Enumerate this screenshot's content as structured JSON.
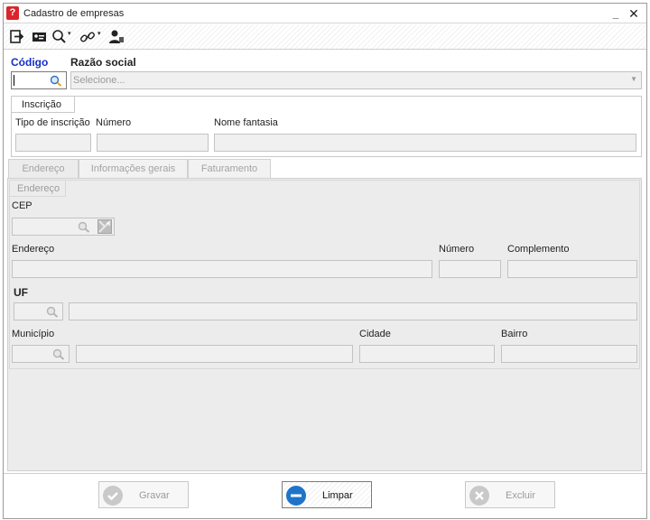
{
  "window": {
    "title": "Cadastro de empresas",
    "app_icon_glyph": "?",
    "minimize_glyph": "_",
    "close_glyph": "✕"
  },
  "toolbar": {
    "icons": [
      "exit-icon",
      "id-card-icon",
      "search-icon",
      "link-icon",
      "user-icon"
    ],
    "caret": "▾"
  },
  "company": {
    "codigo_label": "Código",
    "razao_label": "Razão social",
    "codigo_value": "",
    "razao_placeholder": "Selecione..."
  },
  "inscricao": {
    "group_title": "Inscrição",
    "tipo_label": "Tipo de inscrição",
    "numero_label": "Número",
    "nome_fantasia_label": "Nome fantasia"
  },
  "tabs": [
    {
      "label": "Endereço",
      "active": true
    },
    {
      "label": "Informações gerais",
      "active": false
    },
    {
      "label": "Faturamento",
      "active": false
    }
  ],
  "address": {
    "section_title": "Endereço",
    "cep_label": "CEP",
    "endereco_label": "Endereço",
    "numero_label": "Número",
    "complemento_label": "Complemento",
    "uf_label": "UF",
    "municipio_label": "Município",
    "cidade_label": "Cidade",
    "bairro_label": "Bairro"
  },
  "footer": {
    "save_label": "Gravar",
    "clear_label": "Limpar",
    "delete_label": "Excluir"
  },
  "colors": {
    "accent_blue": "#1530c8",
    "app_red": "#d9252b",
    "clear_button_blue": "#1f74c9",
    "disabled_gray": "#c7c7c7"
  }
}
